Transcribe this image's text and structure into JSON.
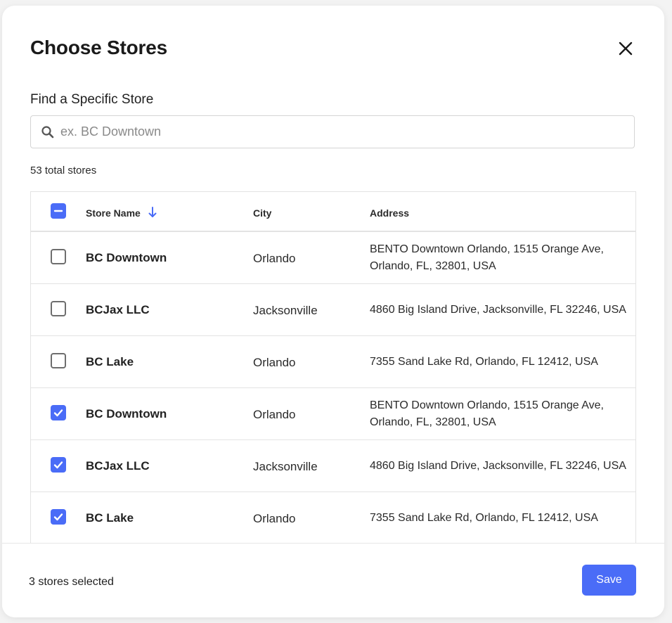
{
  "dialog": {
    "title": "Choose Stores",
    "close_icon": "close-icon"
  },
  "search": {
    "label": "Find a Specific Store",
    "placeholder": "ex. BC Downtown",
    "value": "",
    "icon": "search-icon"
  },
  "summary": {
    "total_text": "53 total stores"
  },
  "table": {
    "header_checkbox_state": "indeterminate",
    "columns": {
      "name": "Store Name",
      "city": "City",
      "address": "Address"
    },
    "sort_icon": "arrow-down-icon",
    "rows": [
      {
        "checked": false,
        "name": "BC Downtown",
        "city": "Orlando",
        "address": "BENTO Downtown Orlando, 1515 Orange Ave, Orlando, FL, 32801, USA"
      },
      {
        "checked": false,
        "name": "BCJax LLC",
        "city": "Jacksonville",
        "address": "4860 Big Island Drive, Jacksonville, FL 32246, USA"
      },
      {
        "checked": false,
        "name": "BC Lake",
        "city": "Orlando",
        "address": "7355 Sand Lake Rd, Orlando, FL 12412, USA"
      },
      {
        "checked": true,
        "name": "BC Downtown",
        "city": "Orlando",
        "address": "BENTO Downtown Orlando, 1515 Orange Ave, Orlando, FL, 32801, USA"
      },
      {
        "checked": true,
        "name": "BCJax LLC",
        "city": "Jacksonville",
        "address": "4860 Big Island Drive, Jacksonville, FL 32246, USA"
      },
      {
        "checked": true,
        "name": "BC Lake",
        "city": "Orlando",
        "address": "7355 Sand Lake Rd, Orlando, FL 12412, USA"
      }
    ]
  },
  "footer": {
    "selected_text": "3 stores selected",
    "save_label": "Save"
  },
  "colors": {
    "accent": "#4a6cf7",
    "border": "#e3e3e3",
    "text": "#1f1f1f"
  }
}
